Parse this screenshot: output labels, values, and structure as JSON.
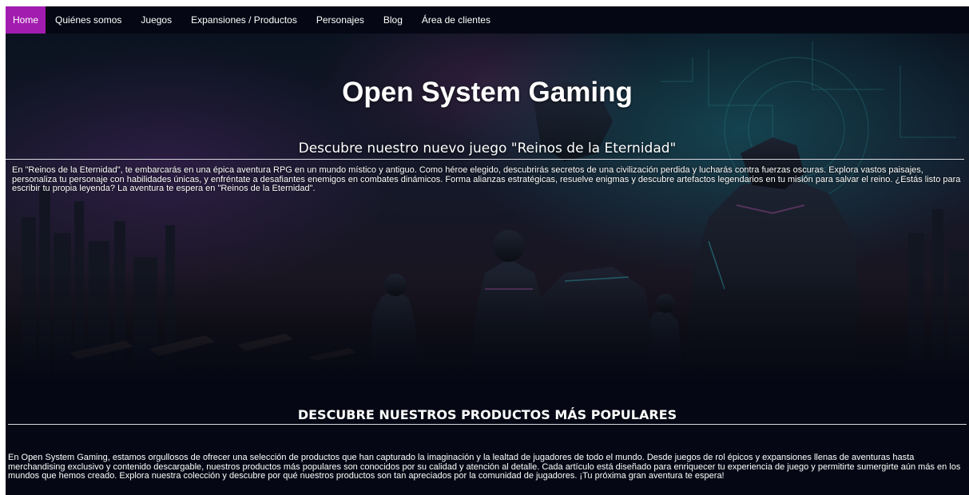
{
  "nav": {
    "items": [
      {
        "label": "Home",
        "active": true
      },
      {
        "label": "Quiénes somos",
        "active": false
      },
      {
        "label": "Juegos",
        "active": false
      },
      {
        "label": "Expansiones / Productos",
        "active": false
      },
      {
        "label": "Personajes",
        "active": false
      },
      {
        "label": "Blog",
        "active": false
      },
      {
        "label": "Área de clientes",
        "active": false
      }
    ]
  },
  "hero": {
    "title": "Open System Gaming",
    "subtitle": "Descubre nuestro nuevo juego \"Reinos de la Eternidad\"",
    "text": "En \"Reinos de la Eternidad\", te embarcarás en una épica aventura RPG en un mundo místico y antiguo. Como héroe elegido, descubrirás secretos de una civilización perdida y lucharás contra fuerzas oscuras. Explora vastos paisajes, personaliza tu personaje con habilidades únicas, y enfréntate a desafiantes enemigos en combates dinámicos. Forma alianzas estratégicas, resuelve enigmas y descubre artefactos legendarios en tu misión para salvar el reino. ¿Estás listo para escribir tu propia leyenda? La aventura te espera en \"Reinos de la Eternidad\"."
  },
  "products": {
    "title": "DESCUBRE NUESTROS PRODUCTOS MÁS POPULARES",
    "text": "En Open System Gaming, estamos orgullosos de ofrecer una selección de productos que han capturado la imaginación y la lealtad de jugadores de todo el mundo. Desde juegos de rol épicos y expansiones llenas de aventuras hasta merchandising exclusivo y contenido descargable, nuestros productos más populares son conocidos por su calidad y atención al detalle. Cada artículo está diseñado para enriquecer tu experiencia de juego y permitirte sumergirte aún más en los mundos que hemos creado. Explora nuestra colección y descubre por qué nuestros productos son tan apreciados por la comunidad de jugadores. ¡Tu próxima gran aventura te espera!"
  },
  "colors": {
    "page_background": "#050814",
    "nav_active": "#a21caf",
    "text": "#ffffff",
    "rule": "#d9d9e0"
  }
}
